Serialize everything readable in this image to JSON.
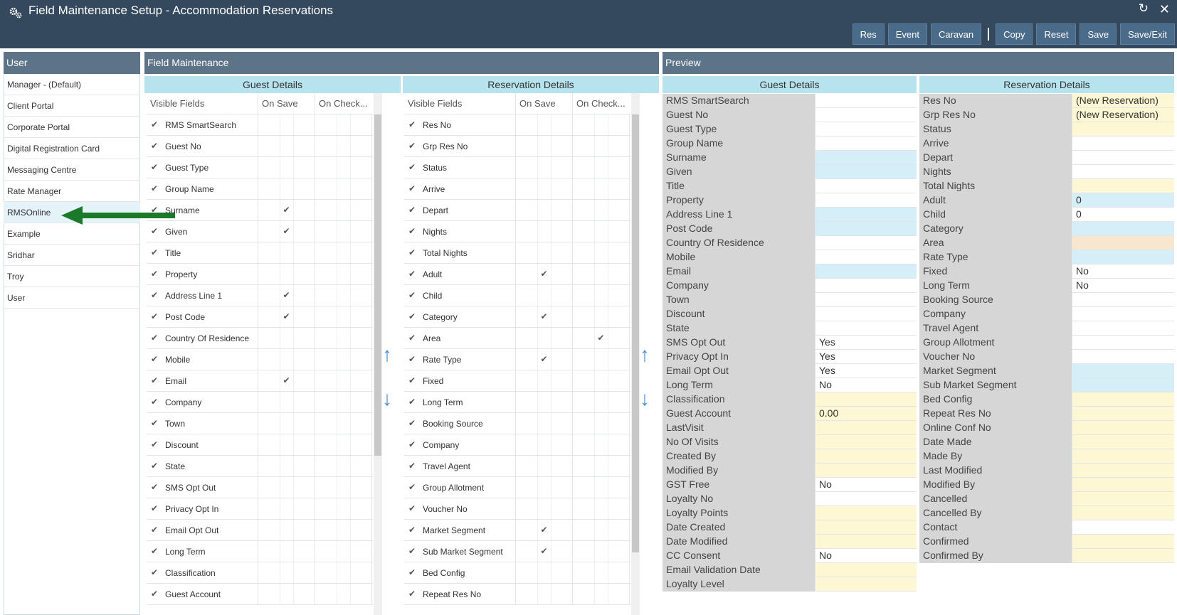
{
  "window": {
    "title": "Field Maintenance Setup - Accommodation Reservations",
    "icon": "gears-icon"
  },
  "toolbar": {
    "buttons": [
      "Res",
      "Event",
      "Caravan"
    ],
    "actions": [
      "Copy",
      "Reset",
      "Save",
      "Save/Exit"
    ]
  },
  "user_panel": {
    "header": "User",
    "items": [
      "Manager - (Default)",
      "Client Portal",
      "Corporate Portal",
      "Digital Registration Card",
      "Messaging Centre",
      "Rate Manager",
      "RMSOnline",
      "Example",
      "Sridhar",
      "Troy",
      "User"
    ],
    "selected": "RMSOnline"
  },
  "field_maintenance": {
    "header": "Field Maintenance",
    "guest": {
      "title": "Guest Details",
      "columns": [
        "Visible Fields",
        "On Save",
        "On Check..."
      ],
      "rows": [
        {
          "name": "RMS SmartSearch",
          "save": false,
          "check": false
        },
        {
          "name": "Guest No",
          "save": false,
          "check": false
        },
        {
          "name": "Guest Type",
          "save": false,
          "check": false
        },
        {
          "name": "Group Name",
          "save": false,
          "check": false
        },
        {
          "name": "Surname",
          "save": true,
          "check": false
        },
        {
          "name": "Given",
          "save": true,
          "check": false
        },
        {
          "name": "Title",
          "save": false,
          "check": false
        },
        {
          "name": "Property",
          "save": false,
          "check": false
        },
        {
          "name": "Address Line 1",
          "save": true,
          "check": false
        },
        {
          "name": "Post Code",
          "save": true,
          "check": false
        },
        {
          "name": "Country Of Residence",
          "save": false,
          "check": false
        },
        {
          "name": "Mobile",
          "save": false,
          "check": false
        },
        {
          "name": "Email",
          "save": true,
          "check": false
        },
        {
          "name": "Company",
          "save": false,
          "check": false
        },
        {
          "name": "Town",
          "save": false,
          "check": false
        },
        {
          "name": "Discount",
          "save": false,
          "check": false
        },
        {
          "name": "State",
          "save": false,
          "check": false
        },
        {
          "name": "SMS Opt Out",
          "save": false,
          "check": false
        },
        {
          "name": "Privacy Opt In",
          "save": false,
          "check": false
        },
        {
          "name": "Email Opt Out",
          "save": false,
          "check": false
        },
        {
          "name": "Long Term",
          "save": false,
          "check": false
        },
        {
          "name": "Classification",
          "save": false,
          "check": false
        },
        {
          "name": "Guest Account",
          "save": false,
          "check": false
        }
      ]
    },
    "reservation": {
      "title": "Reservation Details",
      "columns": [
        "Visible Fields",
        "On Save",
        "On Check..."
      ],
      "rows": [
        {
          "name": "Res No",
          "save": false,
          "check": false
        },
        {
          "name": "Grp Res No",
          "save": false,
          "check": false
        },
        {
          "name": "Status",
          "save": false,
          "check": false
        },
        {
          "name": "Arrive",
          "save": false,
          "check": false
        },
        {
          "name": "Depart",
          "save": false,
          "check": false
        },
        {
          "name": "Nights",
          "save": false,
          "check": false
        },
        {
          "name": "Total Nights",
          "save": false,
          "check": false
        },
        {
          "name": "Adult",
          "save": true,
          "check": false
        },
        {
          "name": "Child",
          "save": false,
          "check": false
        },
        {
          "name": "Category",
          "save": true,
          "check": false
        },
        {
          "name": "Area",
          "save": false,
          "check": true
        },
        {
          "name": "Rate Type",
          "save": true,
          "check": false
        },
        {
          "name": "Fixed",
          "save": false,
          "check": false
        },
        {
          "name": "Long Term",
          "save": false,
          "check": false
        },
        {
          "name": "Booking Source",
          "save": false,
          "check": false
        },
        {
          "name": "Company",
          "save": false,
          "check": false
        },
        {
          "name": "Travel Agent",
          "save": false,
          "check": false
        },
        {
          "name": "Group Allotment",
          "save": false,
          "check": false
        },
        {
          "name": "Voucher No",
          "save": false,
          "check": false
        },
        {
          "name": "Market Segment",
          "save": true,
          "check": false
        },
        {
          "name": "Sub Market Segment",
          "save": true,
          "check": false
        },
        {
          "name": "Bed Config",
          "save": false,
          "check": false
        },
        {
          "name": "Repeat Res No",
          "save": false,
          "check": false
        }
      ]
    }
  },
  "preview": {
    "header": "Preview",
    "guest": {
      "title": "Guest Details",
      "rows": [
        {
          "label": "RMS SmartSearch",
          "value": "",
          "bg": "white"
        },
        {
          "label": "Guest No",
          "value": "",
          "bg": "white"
        },
        {
          "label": "Guest Type",
          "value": "",
          "bg": "white"
        },
        {
          "label": "Group Name",
          "value": "",
          "bg": "white"
        },
        {
          "label": "Surname",
          "value": "",
          "bg": "blue"
        },
        {
          "label": "Given",
          "value": "",
          "bg": "blue"
        },
        {
          "label": "Title",
          "value": "",
          "bg": "white"
        },
        {
          "label": "Property",
          "value": "",
          "bg": "white"
        },
        {
          "label": "Address Line 1",
          "value": "",
          "bg": "blue"
        },
        {
          "label": "Post Code",
          "value": "",
          "bg": "blue"
        },
        {
          "label": "Country Of Residence",
          "value": "",
          "bg": "white"
        },
        {
          "label": "Mobile",
          "value": "",
          "bg": "white"
        },
        {
          "label": "Email",
          "value": "",
          "bg": "blue"
        },
        {
          "label": "Company",
          "value": "",
          "bg": "white"
        },
        {
          "label": "Town",
          "value": "",
          "bg": "white"
        },
        {
          "label": "Discount",
          "value": "",
          "bg": "white"
        },
        {
          "label": "State",
          "value": "",
          "bg": "white"
        },
        {
          "label": "SMS Opt Out",
          "value": "Yes",
          "bg": "white"
        },
        {
          "label": "Privacy Opt In",
          "value": "Yes",
          "bg": "white"
        },
        {
          "label": "Email Opt Out",
          "value": "Yes",
          "bg": "white"
        },
        {
          "label": "Long Term",
          "value": "No",
          "bg": "white"
        },
        {
          "label": "Classification",
          "value": "",
          "bg": "yellow"
        },
        {
          "label": "Guest Account",
          "value": "0.00",
          "bg": "yellow"
        },
        {
          "label": "LastVisit",
          "value": "",
          "bg": "yellow"
        },
        {
          "label": "No Of Visits",
          "value": "",
          "bg": "yellow"
        },
        {
          "label": "Created By",
          "value": "",
          "bg": "yellow"
        },
        {
          "label": "Modified By",
          "value": "",
          "bg": "yellow"
        },
        {
          "label": "GST Free",
          "value": "No",
          "bg": "white"
        },
        {
          "label": "Loyalty No",
          "value": "",
          "bg": "white"
        },
        {
          "label": "Loyalty Points",
          "value": "",
          "bg": "yellow"
        },
        {
          "label": "Date Created",
          "value": "",
          "bg": "yellow"
        },
        {
          "label": "Date Modified",
          "value": "",
          "bg": "yellow"
        },
        {
          "label": "CC Consent",
          "value": "No",
          "bg": "white"
        },
        {
          "label": "Email Validation Date",
          "value": "",
          "bg": "yellow"
        },
        {
          "label": "Loyalty Level",
          "value": "",
          "bg": "yellow"
        }
      ]
    },
    "reservation": {
      "title": "Reservation Details",
      "rows": [
        {
          "label": "Res No",
          "value": "(New Reservation)",
          "bg": "yellow"
        },
        {
          "label": "Grp Res No",
          "value": "(New Reservation)",
          "bg": "yellow"
        },
        {
          "label": "Status",
          "value": "",
          "bg": "yellow"
        },
        {
          "label": "Arrive",
          "value": "",
          "bg": "white"
        },
        {
          "label": "Depart",
          "value": "",
          "bg": "white"
        },
        {
          "label": "Nights",
          "value": "",
          "bg": "white"
        },
        {
          "label": "Total Nights",
          "value": "",
          "bg": "yellow"
        },
        {
          "label": "Adult",
          "value": "0",
          "bg": "blue"
        },
        {
          "label": "Child",
          "value": "0",
          "bg": "white"
        },
        {
          "label": "Category",
          "value": "",
          "bg": "blue"
        },
        {
          "label": "Area",
          "value": "",
          "bg": "peach"
        },
        {
          "label": "Rate Type",
          "value": "",
          "bg": "blue"
        },
        {
          "label": "Fixed",
          "value": "No",
          "bg": "white"
        },
        {
          "label": "Long Term",
          "value": "No",
          "bg": "white"
        },
        {
          "label": "Booking Source",
          "value": "",
          "bg": "white"
        },
        {
          "label": "Company",
          "value": "",
          "bg": "white"
        },
        {
          "label": "Travel Agent",
          "value": "",
          "bg": "white"
        },
        {
          "label": "Group Allotment",
          "value": "",
          "bg": "white"
        },
        {
          "label": "Voucher No",
          "value": "",
          "bg": "white"
        },
        {
          "label": "Market Segment",
          "value": "",
          "bg": "blue"
        },
        {
          "label": "Sub Market Segment",
          "value": "",
          "bg": "blue"
        },
        {
          "label": "Bed Config",
          "value": "",
          "bg": "yellow"
        },
        {
          "label": "Repeat Res No",
          "value": "",
          "bg": "yellow"
        },
        {
          "label": "Online Conf No",
          "value": "",
          "bg": "yellow"
        },
        {
          "label": "Date Made",
          "value": "",
          "bg": "yellow"
        },
        {
          "label": "Made By",
          "value": "",
          "bg": "yellow"
        },
        {
          "label": "Last Modified",
          "value": "",
          "bg": "yellow"
        },
        {
          "label": "Modified By",
          "value": "",
          "bg": "yellow"
        },
        {
          "label": "Cancelled",
          "value": "",
          "bg": "yellow"
        },
        {
          "label": "Cancelled By",
          "value": "",
          "bg": "yellow"
        },
        {
          "label": "Contact",
          "value": "",
          "bg": "white"
        },
        {
          "label": "Confirmed",
          "value": "",
          "bg": "yellow"
        },
        {
          "label": "Confirmed By",
          "value": "",
          "bg": "yellow"
        }
      ]
    }
  },
  "colors": {
    "titlebar": "#34495e",
    "panel_header": "#5d7387",
    "sub_header": "#b7e3ef",
    "arrow": "#1a7a2a",
    "move_arrows": "#3f8fd4"
  }
}
